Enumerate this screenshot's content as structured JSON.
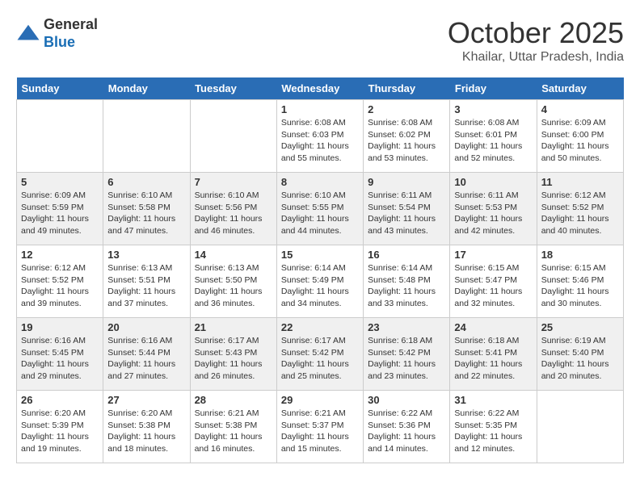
{
  "header": {
    "logo_line1": "General",
    "logo_line2": "Blue",
    "month": "October 2025",
    "location": "Khailar, Uttar Pradesh, India"
  },
  "weekdays": [
    "Sunday",
    "Monday",
    "Tuesday",
    "Wednesday",
    "Thursday",
    "Friday",
    "Saturday"
  ],
  "weeks": [
    [
      {
        "day": "",
        "info": ""
      },
      {
        "day": "",
        "info": ""
      },
      {
        "day": "",
        "info": ""
      },
      {
        "day": "1",
        "info": "Sunrise: 6:08 AM\nSunset: 6:03 PM\nDaylight: 11 hours\nand 55 minutes."
      },
      {
        "day": "2",
        "info": "Sunrise: 6:08 AM\nSunset: 6:02 PM\nDaylight: 11 hours\nand 53 minutes."
      },
      {
        "day": "3",
        "info": "Sunrise: 6:08 AM\nSunset: 6:01 PM\nDaylight: 11 hours\nand 52 minutes."
      },
      {
        "day": "4",
        "info": "Sunrise: 6:09 AM\nSunset: 6:00 PM\nDaylight: 11 hours\nand 50 minutes."
      }
    ],
    [
      {
        "day": "5",
        "info": "Sunrise: 6:09 AM\nSunset: 5:59 PM\nDaylight: 11 hours\nand 49 minutes."
      },
      {
        "day": "6",
        "info": "Sunrise: 6:10 AM\nSunset: 5:58 PM\nDaylight: 11 hours\nand 47 minutes."
      },
      {
        "day": "7",
        "info": "Sunrise: 6:10 AM\nSunset: 5:56 PM\nDaylight: 11 hours\nand 46 minutes."
      },
      {
        "day": "8",
        "info": "Sunrise: 6:10 AM\nSunset: 5:55 PM\nDaylight: 11 hours\nand 44 minutes."
      },
      {
        "day": "9",
        "info": "Sunrise: 6:11 AM\nSunset: 5:54 PM\nDaylight: 11 hours\nand 43 minutes."
      },
      {
        "day": "10",
        "info": "Sunrise: 6:11 AM\nSunset: 5:53 PM\nDaylight: 11 hours\nand 42 minutes."
      },
      {
        "day": "11",
        "info": "Sunrise: 6:12 AM\nSunset: 5:52 PM\nDaylight: 11 hours\nand 40 minutes."
      }
    ],
    [
      {
        "day": "12",
        "info": "Sunrise: 6:12 AM\nSunset: 5:52 PM\nDaylight: 11 hours\nand 39 minutes."
      },
      {
        "day": "13",
        "info": "Sunrise: 6:13 AM\nSunset: 5:51 PM\nDaylight: 11 hours\nand 37 minutes."
      },
      {
        "day": "14",
        "info": "Sunrise: 6:13 AM\nSunset: 5:50 PM\nDaylight: 11 hours\nand 36 minutes."
      },
      {
        "day": "15",
        "info": "Sunrise: 6:14 AM\nSunset: 5:49 PM\nDaylight: 11 hours\nand 34 minutes."
      },
      {
        "day": "16",
        "info": "Sunrise: 6:14 AM\nSunset: 5:48 PM\nDaylight: 11 hours\nand 33 minutes."
      },
      {
        "day": "17",
        "info": "Sunrise: 6:15 AM\nSunset: 5:47 PM\nDaylight: 11 hours\nand 32 minutes."
      },
      {
        "day": "18",
        "info": "Sunrise: 6:15 AM\nSunset: 5:46 PM\nDaylight: 11 hours\nand 30 minutes."
      }
    ],
    [
      {
        "day": "19",
        "info": "Sunrise: 6:16 AM\nSunset: 5:45 PM\nDaylight: 11 hours\nand 29 minutes."
      },
      {
        "day": "20",
        "info": "Sunrise: 6:16 AM\nSunset: 5:44 PM\nDaylight: 11 hours\nand 27 minutes."
      },
      {
        "day": "21",
        "info": "Sunrise: 6:17 AM\nSunset: 5:43 PM\nDaylight: 11 hours\nand 26 minutes."
      },
      {
        "day": "22",
        "info": "Sunrise: 6:17 AM\nSunset: 5:42 PM\nDaylight: 11 hours\nand 25 minutes."
      },
      {
        "day": "23",
        "info": "Sunrise: 6:18 AM\nSunset: 5:42 PM\nDaylight: 11 hours\nand 23 minutes."
      },
      {
        "day": "24",
        "info": "Sunrise: 6:18 AM\nSunset: 5:41 PM\nDaylight: 11 hours\nand 22 minutes."
      },
      {
        "day": "25",
        "info": "Sunrise: 6:19 AM\nSunset: 5:40 PM\nDaylight: 11 hours\nand 20 minutes."
      }
    ],
    [
      {
        "day": "26",
        "info": "Sunrise: 6:20 AM\nSunset: 5:39 PM\nDaylight: 11 hours\nand 19 minutes."
      },
      {
        "day": "27",
        "info": "Sunrise: 6:20 AM\nSunset: 5:38 PM\nDaylight: 11 hours\nand 18 minutes."
      },
      {
        "day": "28",
        "info": "Sunrise: 6:21 AM\nSunset: 5:38 PM\nDaylight: 11 hours\nand 16 minutes."
      },
      {
        "day": "29",
        "info": "Sunrise: 6:21 AM\nSunset: 5:37 PM\nDaylight: 11 hours\nand 15 minutes."
      },
      {
        "day": "30",
        "info": "Sunrise: 6:22 AM\nSunset: 5:36 PM\nDaylight: 11 hours\nand 14 minutes."
      },
      {
        "day": "31",
        "info": "Sunrise: 6:22 AM\nSunset: 5:35 PM\nDaylight: 11 hours\nand 12 minutes."
      },
      {
        "day": "",
        "info": ""
      }
    ]
  ]
}
